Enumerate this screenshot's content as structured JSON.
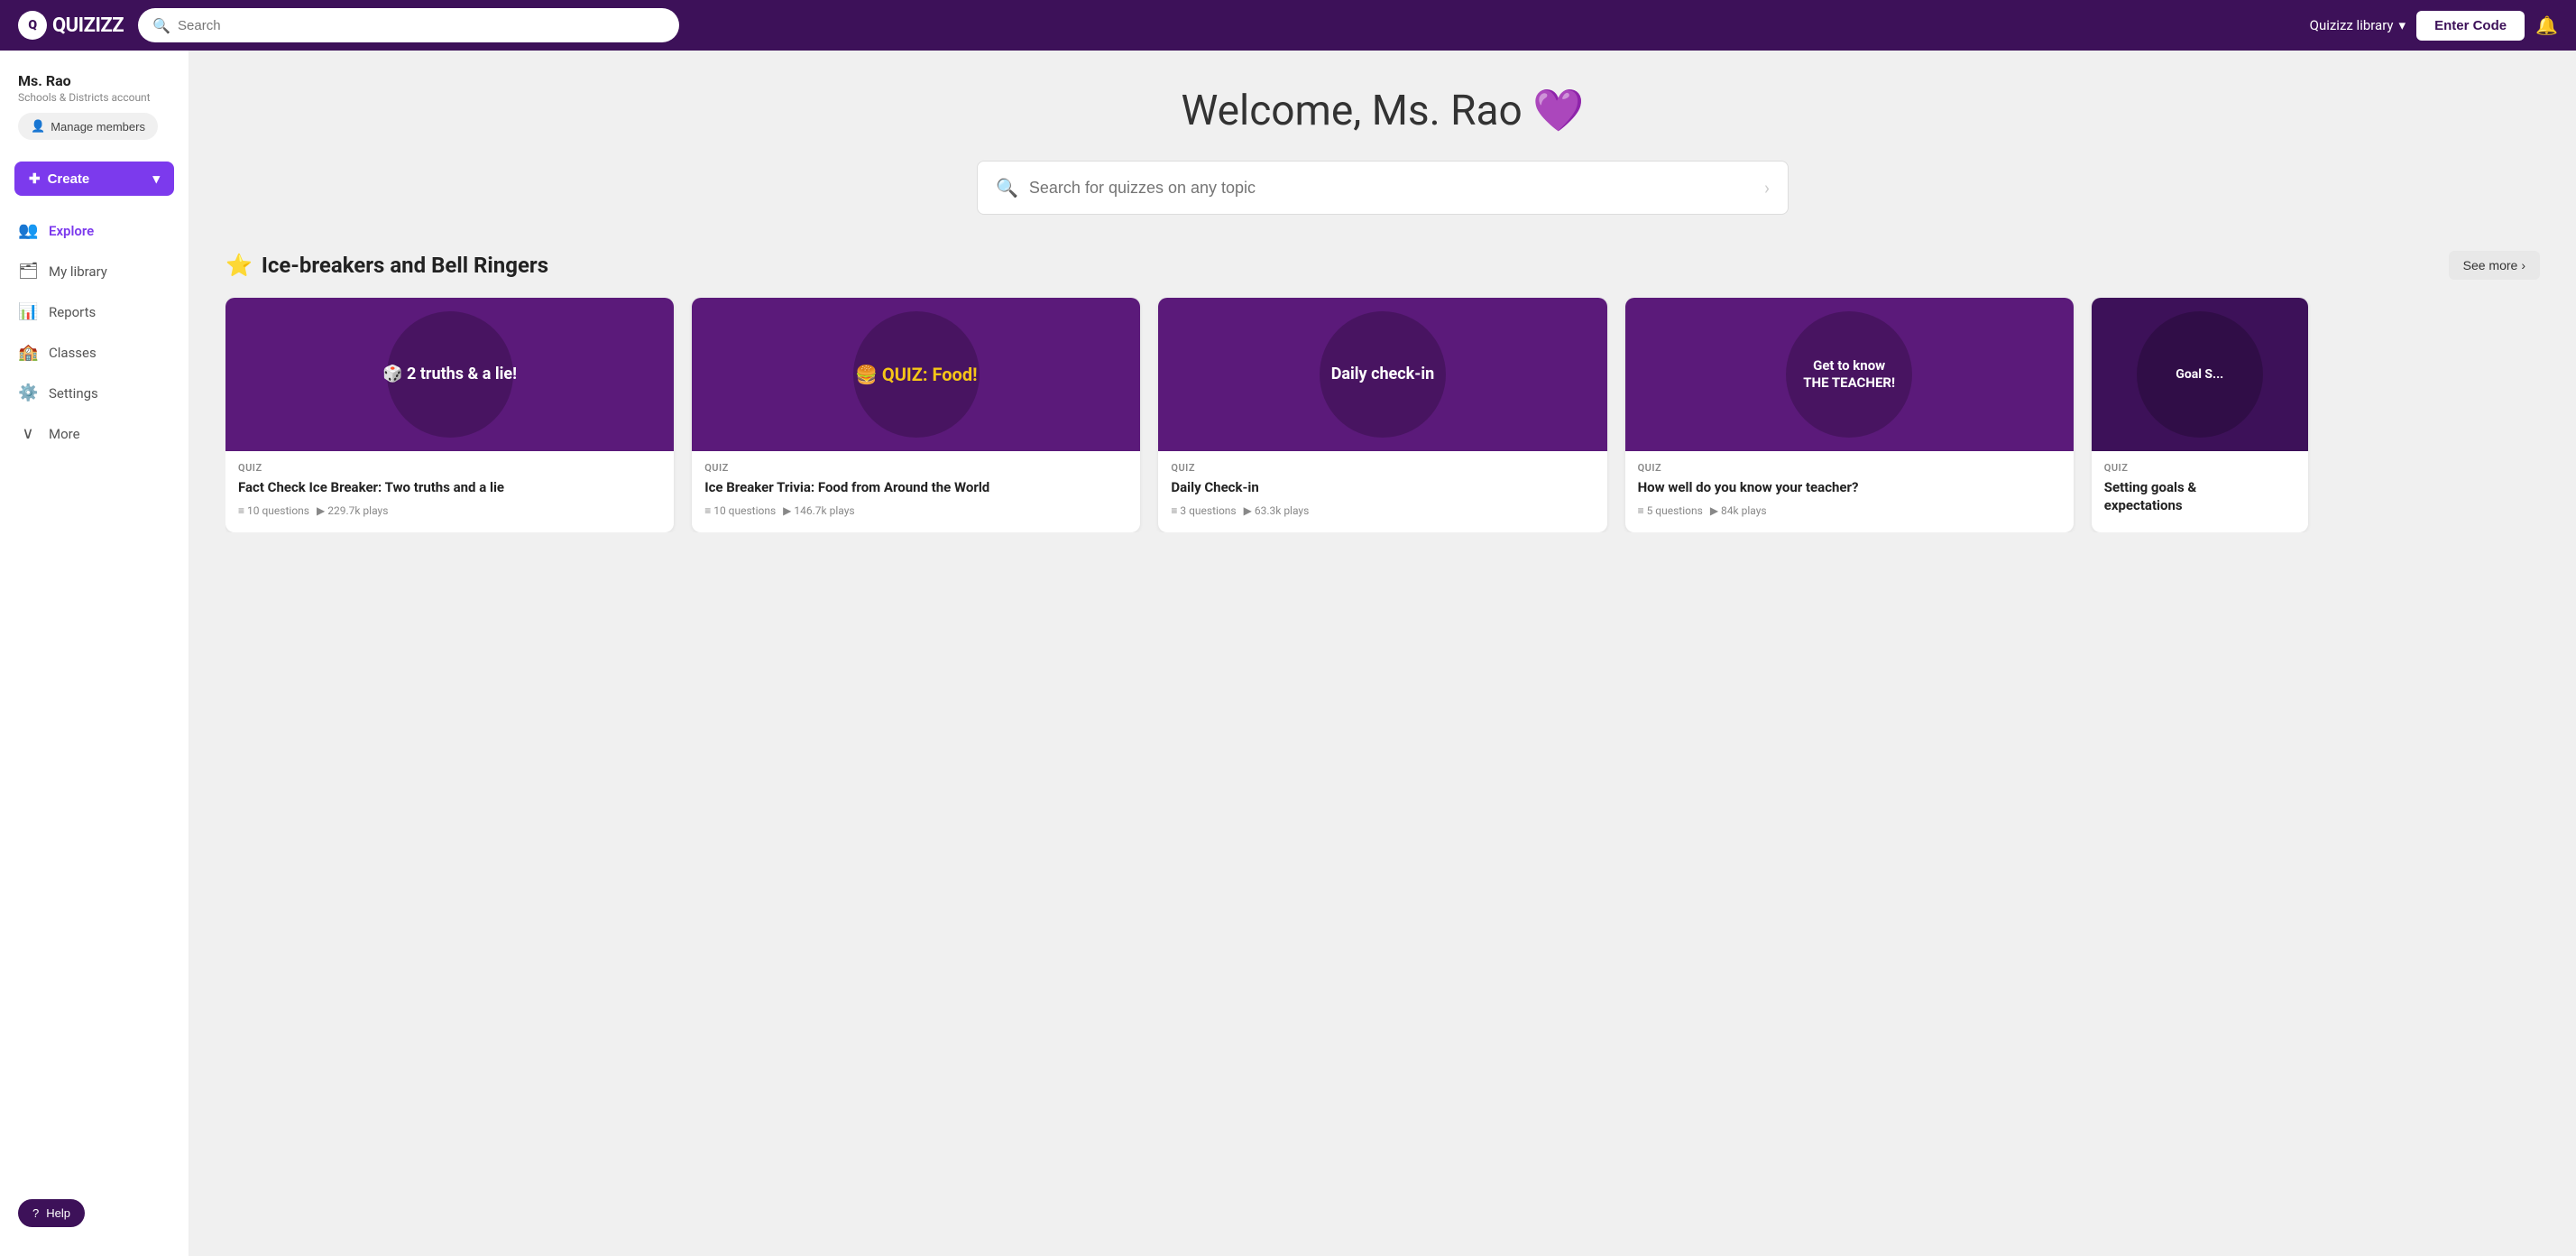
{
  "app": {
    "logo_text": "QUIZIZZ",
    "logo_initial": "Q"
  },
  "topnav": {
    "search_placeholder": "Search",
    "library_label": "Quizizz library",
    "enter_code_label": "Enter Code",
    "notification_icon": "bell-icon"
  },
  "sidebar": {
    "user_name": "Ms. Rao",
    "user_account": "Schools & Districts account",
    "manage_btn": "Manage members",
    "create_btn": "Create",
    "nav_items": [
      {
        "id": "explore",
        "label": "Explore",
        "icon": "👥",
        "active": true
      },
      {
        "id": "my-library",
        "label": "My library",
        "icon": "🗂",
        "active": false
      },
      {
        "id": "reports",
        "label": "Reports",
        "icon": "📊",
        "active": false
      },
      {
        "id": "classes",
        "label": "Classes",
        "icon": "🏫",
        "active": false
      },
      {
        "id": "settings",
        "label": "Settings",
        "icon": "⚙️",
        "active": false
      },
      {
        "id": "more",
        "label": "More",
        "icon": "∨",
        "active": false
      }
    ],
    "help_btn": "Help"
  },
  "main": {
    "welcome_text": "Welcome, Ms. Rao",
    "welcome_heart": "💜",
    "search_placeholder": "Search for quizzes on any topic",
    "section": {
      "title": "Ice-breakers and Bell Ringers",
      "star_icon": "⭐",
      "see_more_label": "See more"
    },
    "cards": [
      {
        "tag": "QUIZ",
        "title": "Fact Check Ice Breaker: Two truths and a lie",
        "thumb_text": "2 truths & a lie!",
        "thumb_bg": "#5b1a7a",
        "meta_questions": "10 questions",
        "meta_plays": "229.7k plays"
      },
      {
        "tag": "QUIZ",
        "title": "Ice Breaker Trivia: Food from Around the World",
        "thumb_text": "QUIZ: Food!",
        "thumb_bg": "#5b1a7a",
        "meta_questions": "10 questions",
        "meta_plays": "146.7k plays"
      },
      {
        "tag": "QUIZ",
        "title": "Daily Check-in",
        "thumb_text": "Daily check-in",
        "thumb_bg": "#5b1a7a",
        "meta_questions": "3 questions",
        "meta_plays": "63.3k plays"
      },
      {
        "tag": "QUIZ",
        "title": "How well do you know your teacher?",
        "thumb_text": "Get to know THE TEACHER!",
        "thumb_bg": "#5b1a7a",
        "meta_questions": "5 questions",
        "meta_plays": "84k plays"
      },
      {
        "tag": "QUIZ",
        "title": "Setting goals & expectations",
        "thumb_text": "Goal S...",
        "thumb_bg": "#3d1159",
        "meta_questions": "",
        "meta_plays": "",
        "partial": true
      }
    ]
  }
}
